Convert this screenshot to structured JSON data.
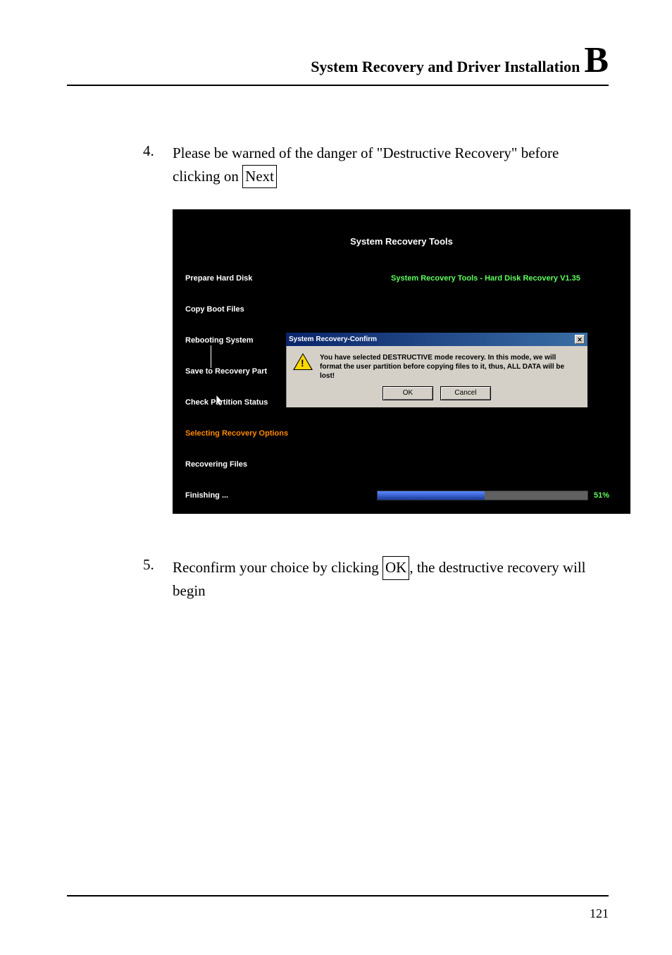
{
  "header": {
    "title": "System Recovery and Driver Installation",
    "letter": "B"
  },
  "steps": [
    {
      "num": "4.",
      "text_before": "Please be warned of the danger of \"Destructive Recovery\" before clicking on ",
      "boxed": "Next",
      "text_after": ""
    },
    {
      "num": "5.",
      "text_before": "Reconfirm your choice by clicking ",
      "boxed": "OK",
      "text_after": ", the destructive recovery will begin"
    }
  ],
  "screenshot": {
    "title": "System Recovery Tools",
    "right_title": "System Recovery Tools - Hard Disk Recovery V1.35",
    "side_steps": [
      "Prepare Hard Disk",
      "Copy Boot Files",
      "Rebooting System",
      "Save to Recovery Part",
      "Check Partition Status",
      "Selecting Recovery Options",
      "Recovering Files",
      "Finishing ..."
    ],
    "active_step_index": 5,
    "dialog": {
      "title": "System Recovery-Confirm",
      "message": "You have selected DESTRUCTIVE mode recovery.  In this mode, we will format the user partition before copying files to it, thus, ALL DATA will be lost!",
      "ok": "OK",
      "cancel": "Cancel"
    },
    "progress_pct": "51%"
  },
  "page_number": "121"
}
